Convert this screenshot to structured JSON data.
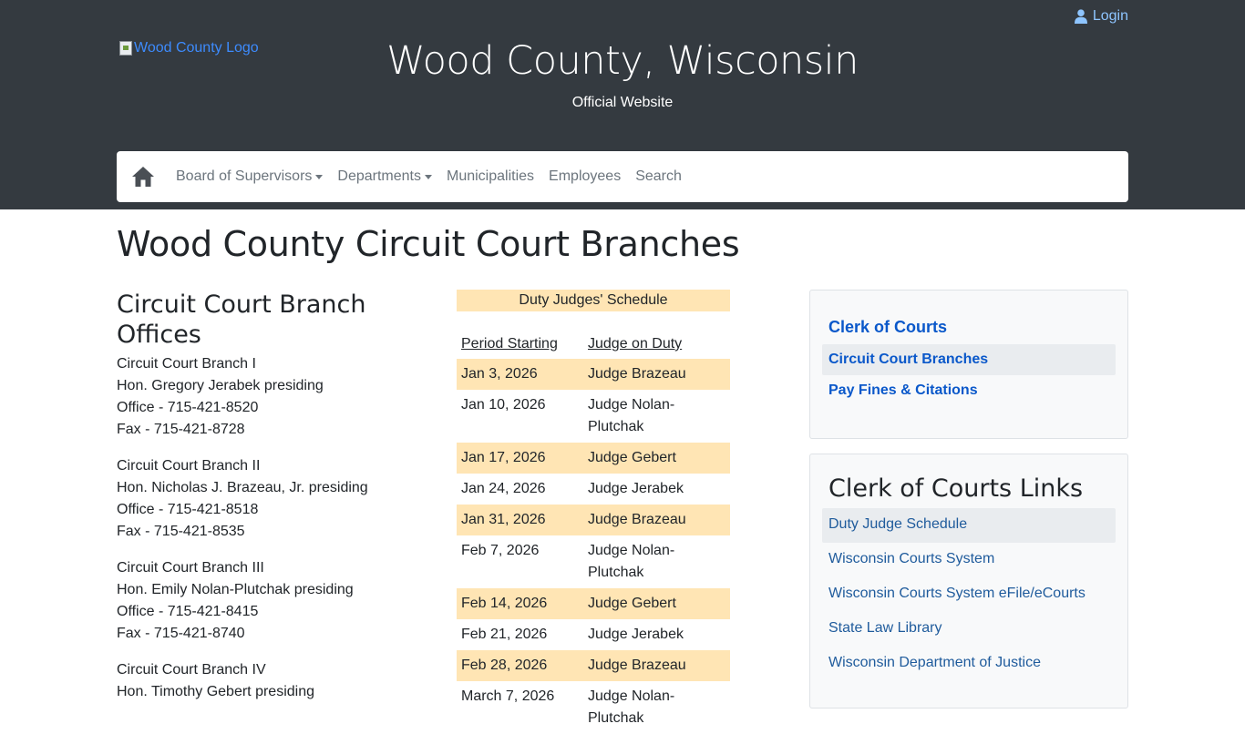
{
  "header": {
    "logo_alt": "Wood County Logo",
    "login_label": "Login",
    "site_title": "Wood County, Wisconsin",
    "site_subtitle": "Official Website"
  },
  "nav": {
    "items": [
      {
        "label": "Board of Supervisors",
        "dropdown": true
      },
      {
        "label": "Departments",
        "dropdown": true
      },
      {
        "label": "Municipalities",
        "dropdown": false
      },
      {
        "label": "Employees",
        "dropdown": false
      },
      {
        "label": "Search",
        "dropdown": false
      }
    ]
  },
  "page_title": "Wood County Circuit Court Branches",
  "offices": {
    "heading": "Circuit Court Branch Offices",
    "branches": [
      {
        "name": "Circuit Court Branch I",
        "judge": "Hon. Gregory Jerabek presiding",
        "office": "Office - 715-421-8520",
        "fax": "Fax - 715-421-8728"
      },
      {
        "name": "Circuit Court Branch II",
        "judge": "Hon. Nicholas J. Brazeau, Jr. presiding",
        "office": "Office - 715-421-8518",
        "fax": "Fax - 715-421-8535"
      },
      {
        "name": "Circuit Court Branch III",
        "judge": "Hon. Emily Nolan-Plutchak presiding",
        "office": "Office - 715-421-8415",
        "fax": "Fax - 715-421-8740"
      },
      {
        "name": "Circuit Court Branch IV",
        "judge": "Hon. Timothy Gebert presiding",
        "office": "",
        "fax": ""
      }
    ]
  },
  "schedule": {
    "title": "Duty Judges' Schedule",
    "col_period": "Period Starting",
    "col_judge": "Judge on Duty",
    "rows": [
      {
        "date": "Jan 3, 2026",
        "judge": "Judge Brazeau"
      },
      {
        "date": "Jan 10, 2026",
        "judge": "Judge Nolan-Plutchak"
      },
      {
        "date": "Jan 17, 2026",
        "judge": "Judge Gebert"
      },
      {
        "date": "Jan 24, 2026",
        "judge": "Judge Jerabek"
      },
      {
        "date": "Jan 31, 2026",
        "judge": "Judge Brazeau"
      },
      {
        "date": "Feb 7, 2026",
        "judge": "Judge Nolan-Plutchak"
      },
      {
        "date": "Feb 14, 2026",
        "judge": "Judge Gebert"
      },
      {
        "date": "Feb 21, 2026",
        "judge": "Judge Jerabek"
      },
      {
        "date": "Feb 28, 2026",
        "judge": "Judge Brazeau"
      },
      {
        "date": "March 7, 2026",
        "judge": "Judge Nolan-Plutchak"
      }
    ]
  },
  "sidebar": {
    "menu": [
      {
        "label": "Clerk of Courts"
      },
      {
        "label": "Circuit Court Branches"
      },
      {
        "label": "Pay Fines & Citations"
      }
    ],
    "links_heading": "Clerk of Courts Links",
    "links": [
      {
        "label": "Duty Judge Schedule"
      },
      {
        "label": "Wisconsin Courts System"
      },
      {
        "label": "Wisconsin Courts System eFile/eCourts"
      },
      {
        "label": "State Law Library"
      },
      {
        "label": "Wisconsin Department of Justice"
      }
    ]
  },
  "colors": {
    "header_bg": "#343a40",
    "schedule_highlight": "#ffe5b4",
    "link": "#0a58ca"
  }
}
